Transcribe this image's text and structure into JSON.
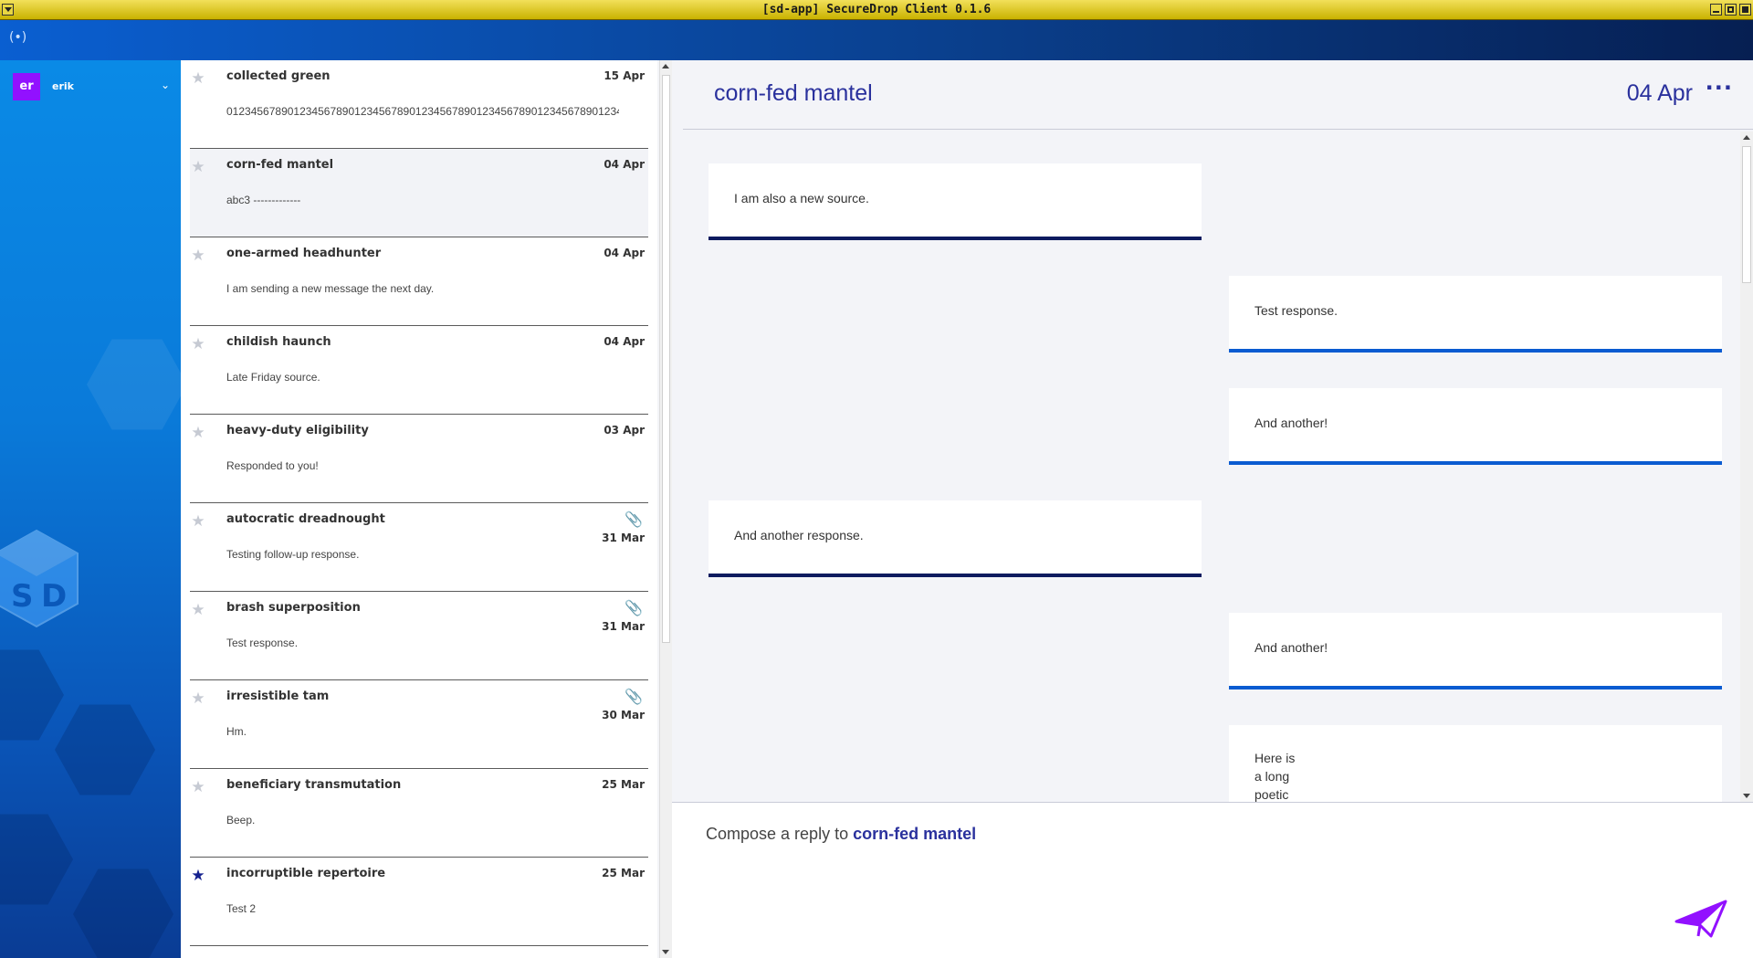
{
  "window": {
    "title": "[sd-app] SecureDrop Client 0.1.6"
  },
  "user": {
    "initials": "er",
    "name": "erik"
  },
  "sources": [
    {
      "name": "collected green",
      "date": "15 Apr",
      "preview": "01234567890123456789012345678901234567890123456789012345678901234567890...",
      "starred": false,
      "attachment": false,
      "selected": false
    },
    {
      "name": "corn-fed mantel",
      "date": "04 Apr",
      "preview": "abc3 -------------",
      "starred": false,
      "attachment": false,
      "selected": true
    },
    {
      "name": "one-armed headhunter",
      "date": "04 Apr",
      "preview": "I am sending a new message the next day.",
      "starred": false,
      "attachment": false,
      "selected": false
    },
    {
      "name": "childish haunch",
      "date": "04 Apr",
      "preview": "Late Friday source.",
      "starred": false,
      "attachment": false,
      "selected": false
    },
    {
      "name": "heavy-duty eligibility",
      "date": "03 Apr",
      "preview": "Responded to you!",
      "starred": false,
      "attachment": false,
      "selected": false
    },
    {
      "name": "autocratic dreadnought",
      "date": "31 Mar",
      "preview": "Testing follow-up response.",
      "starred": false,
      "attachment": true,
      "selected": false
    },
    {
      "name": "brash superposition",
      "date": "31 Mar",
      "preview": "Test response.",
      "starred": false,
      "attachment": true,
      "selected": false
    },
    {
      "name": "irresistible tam",
      "date": "30 Mar",
      "preview": "Hm.",
      "starred": false,
      "attachment": true,
      "selected": false
    },
    {
      "name": "beneficiary transmutation",
      "date": "25 Mar",
      "preview": "Beep.",
      "starred": false,
      "attachment": false,
      "selected": false
    },
    {
      "name": "incorruptible repertoire",
      "date": "25 Mar",
      "preview": "Test 2",
      "starred": true,
      "attachment": false,
      "selected": false
    }
  ],
  "conversation": {
    "title": "corn-fed mantel",
    "date": "04 Apr",
    "menu_icon": "···",
    "items": [
      {
        "kind": "msg",
        "text": "I am also a new source."
      },
      {
        "kind": "reply",
        "text": "Test response."
      },
      {
        "kind": "reply",
        "text": "And another!"
      },
      {
        "kind": "msg",
        "text": "And another response."
      },
      {
        "kind": "reply",
        "text": "And another!"
      },
      {
        "kind": "poem",
        "lines": [
          "Here is",
          "a long",
          "poetic"
        ]
      }
    ]
  },
  "compose": {
    "prefix": "Compose a reply to ",
    "source_name": "corn-fed mantel"
  },
  "colors": {
    "accent": "#2a319d",
    "message_border": "#0d1b5f",
    "reply_border": "#0a5bd1",
    "avatar": "#9211ff",
    "send": "#9211ff"
  },
  "icons": {
    "signal": "signal-icon",
    "star": "star-icon",
    "attachment": "paperclip-icon",
    "send": "send-icon",
    "menu": "more-icon"
  }
}
